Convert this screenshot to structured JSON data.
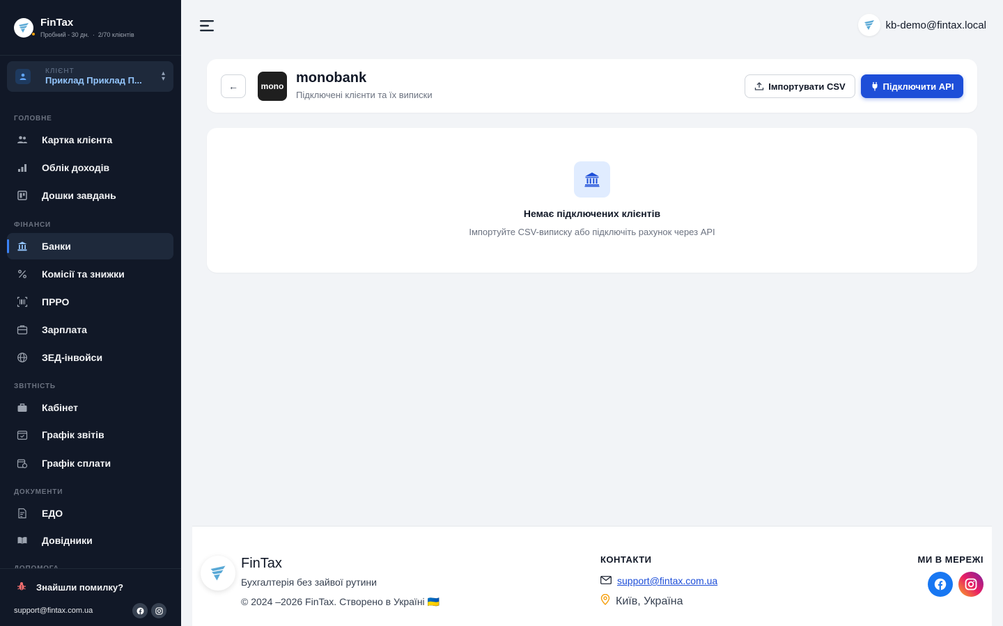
{
  "sidebar": {
    "brand": {
      "name": "FinTax",
      "plan": "Пробний - 30 дн.",
      "clients": "2/70 клієнтів"
    },
    "client": {
      "label": "КЛІЄНТ",
      "name": "Приклад Приклад П..."
    },
    "sections": [
      {
        "title": "ГОЛОВНЕ",
        "items": [
          {
            "label": "Картка клієнта",
            "icon": "users-icon"
          },
          {
            "label": "Облік доходів",
            "icon": "bar-chart-icon"
          },
          {
            "label": "Дошки завдань",
            "icon": "board-icon"
          }
        ]
      },
      {
        "title": "ФІНАНСИ",
        "items": [
          {
            "label": "Банки",
            "icon": "bank-icon",
            "active": true
          },
          {
            "label": "Комісії та знижки",
            "icon": "percent-icon"
          },
          {
            "label": "ПРРО",
            "icon": "barcode-icon"
          },
          {
            "label": "Зарплата",
            "icon": "wallet-icon"
          },
          {
            "label": "ЗЕД-інвойси",
            "icon": "globe-icon"
          }
        ]
      },
      {
        "title": "ЗВІТНІСТЬ",
        "items": [
          {
            "label": "Кабінет",
            "icon": "briefcase-icon"
          },
          {
            "label": "Графік звітів",
            "icon": "calendar-check-icon"
          },
          {
            "label": "Графік сплати",
            "icon": "calendar-money-icon"
          }
        ]
      },
      {
        "title": "ДОКУМЕНТИ",
        "items": [
          {
            "label": "ЕДО",
            "icon": "document-sign-icon"
          },
          {
            "label": "Довідники",
            "icon": "book-icon"
          }
        ]
      },
      {
        "title": "ДОПОМОГА",
        "items": []
      }
    ],
    "bug_report": "Знайшли помилку?",
    "support_email": "support@fintax.com.ua"
  },
  "header": {
    "user_email": "kb-demo@fintax.local"
  },
  "bank": {
    "logo_text": "mono",
    "title": "monobank",
    "subtitle": "Підключені клієнти та їх виписки",
    "import_label": "Імпортувати CSV",
    "api_label": "Підключити API"
  },
  "empty_state": {
    "title": "Немає підключених клієнтів",
    "subtitle": "Імпортуйте CSV-виписку або підключіть рахунок через API"
  },
  "footer": {
    "name": "FinTax",
    "tagline": "Бухгалтерія без зайвої рутини",
    "copyright": "© 2024 –2026 FinTax. Створено в Україні 🇺🇦",
    "contacts_title": "КОНТАКТИ",
    "email": "support@fintax.com.ua",
    "city": "Київ, Україна",
    "social_title": "МИ В МЕРЕЖІ"
  },
  "colors": {
    "accent": "#1d4ed8",
    "sidebar_bg": "#111827",
    "active_link": "#93c5fd"
  }
}
